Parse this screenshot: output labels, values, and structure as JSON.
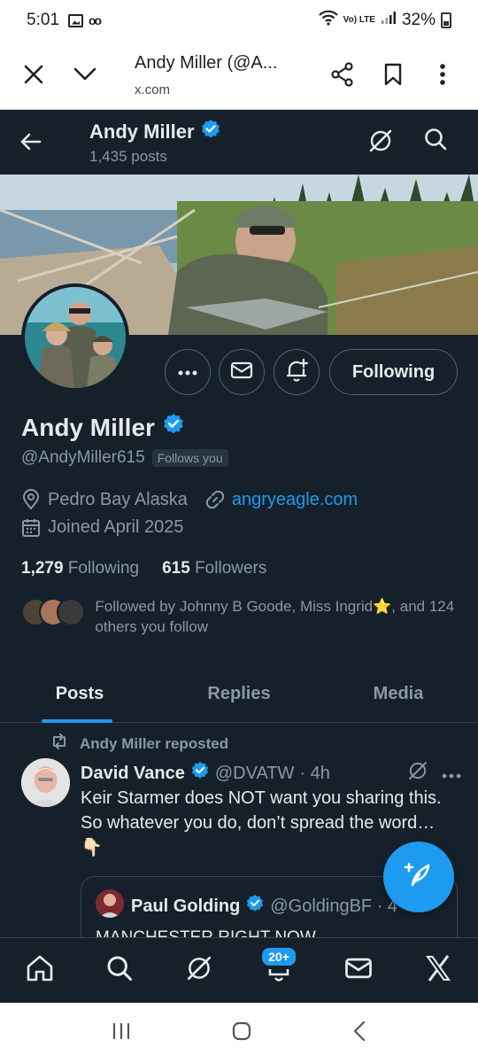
{
  "status_bar": {
    "time": "5:01",
    "network": "Vo) LTE",
    "battery": "32%"
  },
  "browser": {
    "title": "Andy Miller (@A...",
    "url": "x.com"
  },
  "header": {
    "name": "Andy Miller",
    "posts_count": "1,435 posts"
  },
  "profile": {
    "name": "Andy Miller",
    "handle": "@AndyMiller615",
    "follows_you": "Follows you",
    "location": "Pedro Bay Alaska",
    "website": "angryeagle.com",
    "joined": "Joined April 2025",
    "following_count": "1,279",
    "following_label": "Following",
    "followers_count": "615",
    "followers_label": "Followers",
    "followed_by": "Followed by Johnny B Goode, Miss Ingrid⭐, and 124 others you follow",
    "follow_button": "Following"
  },
  "tabs": [
    {
      "label": "Posts",
      "active": true
    },
    {
      "label": "Replies",
      "active": false
    },
    {
      "label": "Media",
      "active": false
    }
  ],
  "tweet": {
    "repost_label": "Andy Miller reposted",
    "author_name": "David Vance",
    "author_handle": "@DVATW",
    "time": "· 4h",
    "text": "Keir Starmer does NOT want you sharing this. So whatever you do, don’t spread the word…👇🏻",
    "quote": {
      "author_name": "Paul Golding",
      "author_handle": "@GoldingBF · 4",
      "text": "MANCHESTER RIGHT NOW"
    }
  },
  "bottom_nav": {
    "notifications_badge": "20+"
  },
  "colors": {
    "background": "#15202b",
    "accent": "#1d9bf0",
    "muted": "#8b98a5",
    "text": "#e7e9ea",
    "border": "#38444d"
  }
}
